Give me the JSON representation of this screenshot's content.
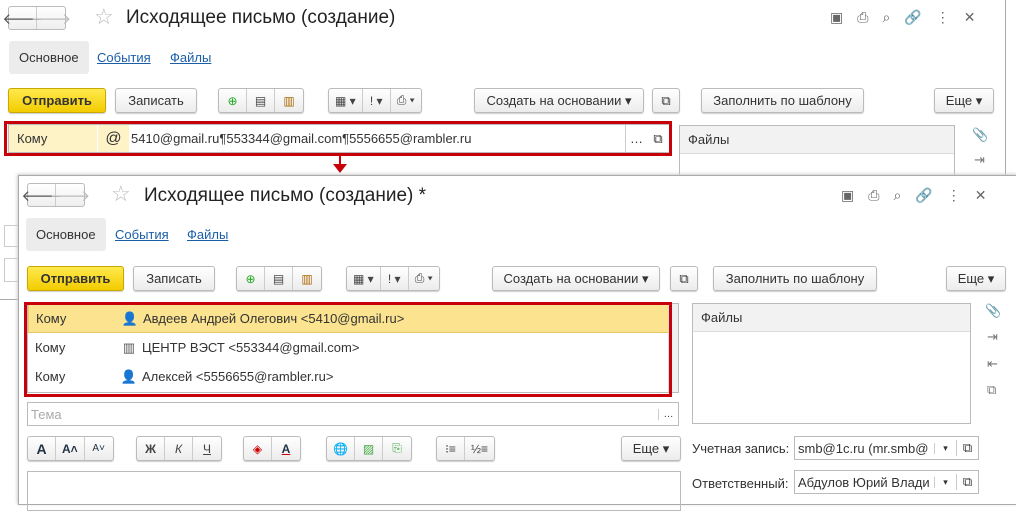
{
  "back": {
    "title": "Исходящее письмо  (создание)",
    "tabs": [
      "Основное",
      "События",
      "Файлы"
    ],
    "toolbar": {
      "send": "Отправить",
      "save": "Записать",
      "create_based": "Создать на основании",
      "fill_template": "Заполнить по шаблону",
      "more": "Еще"
    },
    "to_label": "Кому",
    "to_value": "5410@gmail.ru¶553344@gmail.com¶5556655@rambler.ru",
    "files": "Файлы"
  },
  "front": {
    "title": "Исходящее письмо  (создание) *",
    "tabs": [
      "Основное",
      "События",
      "Файлы"
    ],
    "toolbar": {
      "send": "Отправить",
      "save": "Записать",
      "create_based": "Создать на основании",
      "fill_template": "Заполнить по шаблону",
      "more": "Еще"
    },
    "recipients": [
      {
        "label": "Кому",
        "value": "Авдеев Андрей Олегович <5410@gmail.ru>",
        "icon": "person-icon"
      },
      {
        "label": "Кому",
        "value": "ЦЕНТР ВЭСТ <553344@gmail.com>",
        "icon": "building-icon"
      },
      {
        "label": "Кому",
        "value": "Алексей <5556655@rambler.ru>",
        "icon": "person-icon"
      }
    ],
    "subject_placeholder": "Тема",
    "files": "Файлы",
    "format_more": "Еще",
    "account_label": "Учетная запись:",
    "account_value": "smb@1c.ru (mr.smb@",
    "responsible_label": "Ответственный:",
    "responsible_value": "Абдулов Юрий Влади"
  },
  "colors": {
    "accent": "#c8000a",
    "send": "#f3cc00"
  }
}
